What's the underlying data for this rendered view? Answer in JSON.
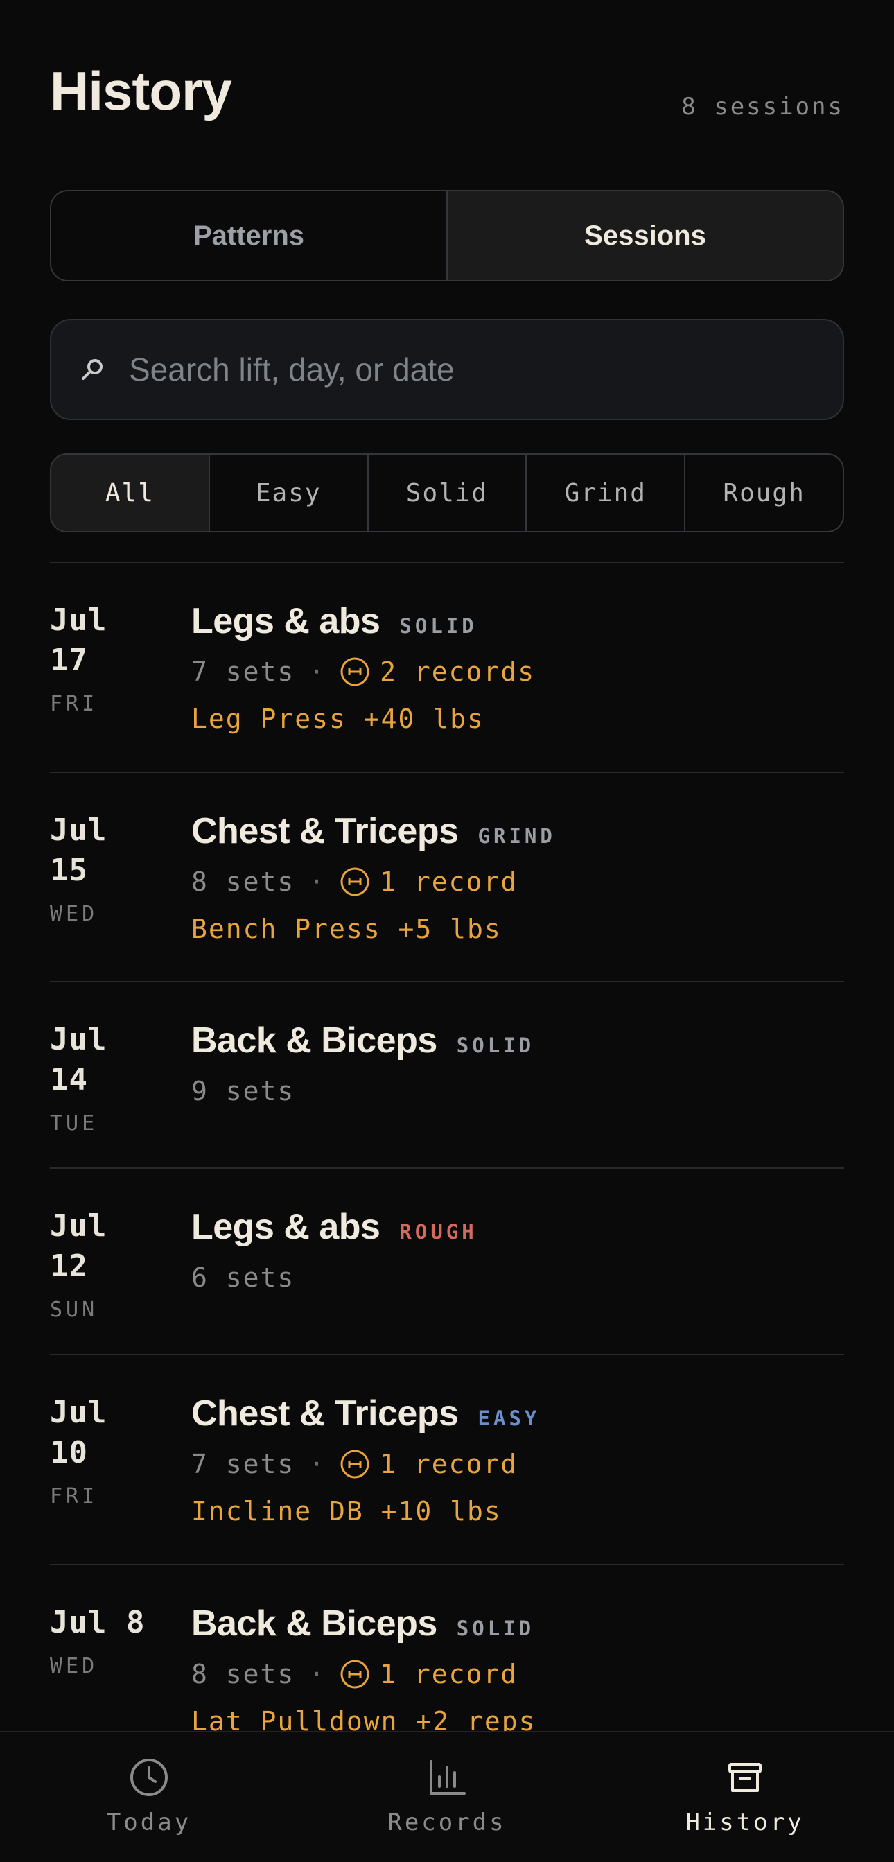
{
  "header": {
    "title": "History",
    "session_count": "8 sessions"
  },
  "view_toggle": [
    {
      "label": "Patterns",
      "active": false
    },
    {
      "label": "Sessions",
      "active": true
    }
  ],
  "search": {
    "placeholder": "Search lift, day, or date",
    "value": ""
  },
  "filters": [
    {
      "label": "All",
      "active": true
    },
    {
      "label": "Easy",
      "active": false
    },
    {
      "label": "Solid",
      "active": false
    },
    {
      "label": "Grind",
      "active": false
    },
    {
      "label": "Rough",
      "active": false
    }
  ],
  "sessions": [
    {
      "date": "Jul",
      "day": "17",
      "dow": "FRI",
      "title": "Legs & abs",
      "tag": "SOLID",
      "tag_kind": "solid",
      "sets": "7 sets",
      "records": "2 records",
      "pr": "Leg Press +40 lbs"
    },
    {
      "date": "Jul",
      "day": "15",
      "dow": "WED",
      "title": "Chest & Triceps",
      "tag": "GRIND",
      "tag_kind": "grind",
      "sets": "8 sets",
      "records": "1 record",
      "pr": "Bench Press +5 lbs"
    },
    {
      "date": "Jul",
      "day": "14",
      "dow": "TUE",
      "title": "Back & Biceps",
      "tag": "SOLID",
      "tag_kind": "solid",
      "sets": "9 sets",
      "records": "",
      "pr": ""
    },
    {
      "date": "Jul",
      "day": "12",
      "dow": "SUN",
      "title": "Legs & abs",
      "tag": "ROUGH",
      "tag_kind": "rough",
      "sets": "6 sets",
      "records": "",
      "pr": ""
    },
    {
      "date": "Jul",
      "day": "10",
      "dow": "FRI",
      "title": "Chest & Triceps",
      "tag": "EASY",
      "tag_kind": "easy",
      "sets": "7 sets",
      "records": "1 record",
      "pr": "Incline DB +10 lbs"
    },
    {
      "date": "Jul 8",
      "day": "",
      "dow": "WED",
      "title": "Back & Biceps",
      "tag": "SOLID",
      "tag_kind": "solid",
      "sets": "8 sets",
      "records": "1 record",
      "pr": "Lat Pulldown +2 reps"
    }
  ],
  "bottom_nav": [
    {
      "label": "Today",
      "icon": "clock-icon",
      "active": false
    },
    {
      "label": "Records",
      "icon": "bar-chart-icon",
      "active": false
    },
    {
      "label": "History",
      "icon": "archive-icon",
      "active": true
    }
  ],
  "colors": {
    "background": "#0a0a0a",
    "accent_record": "#e8a43d",
    "tag_rough": "#d46a5c",
    "tag_easy": "#6d8fc9",
    "tag_neutral": "#9a9da2"
  }
}
